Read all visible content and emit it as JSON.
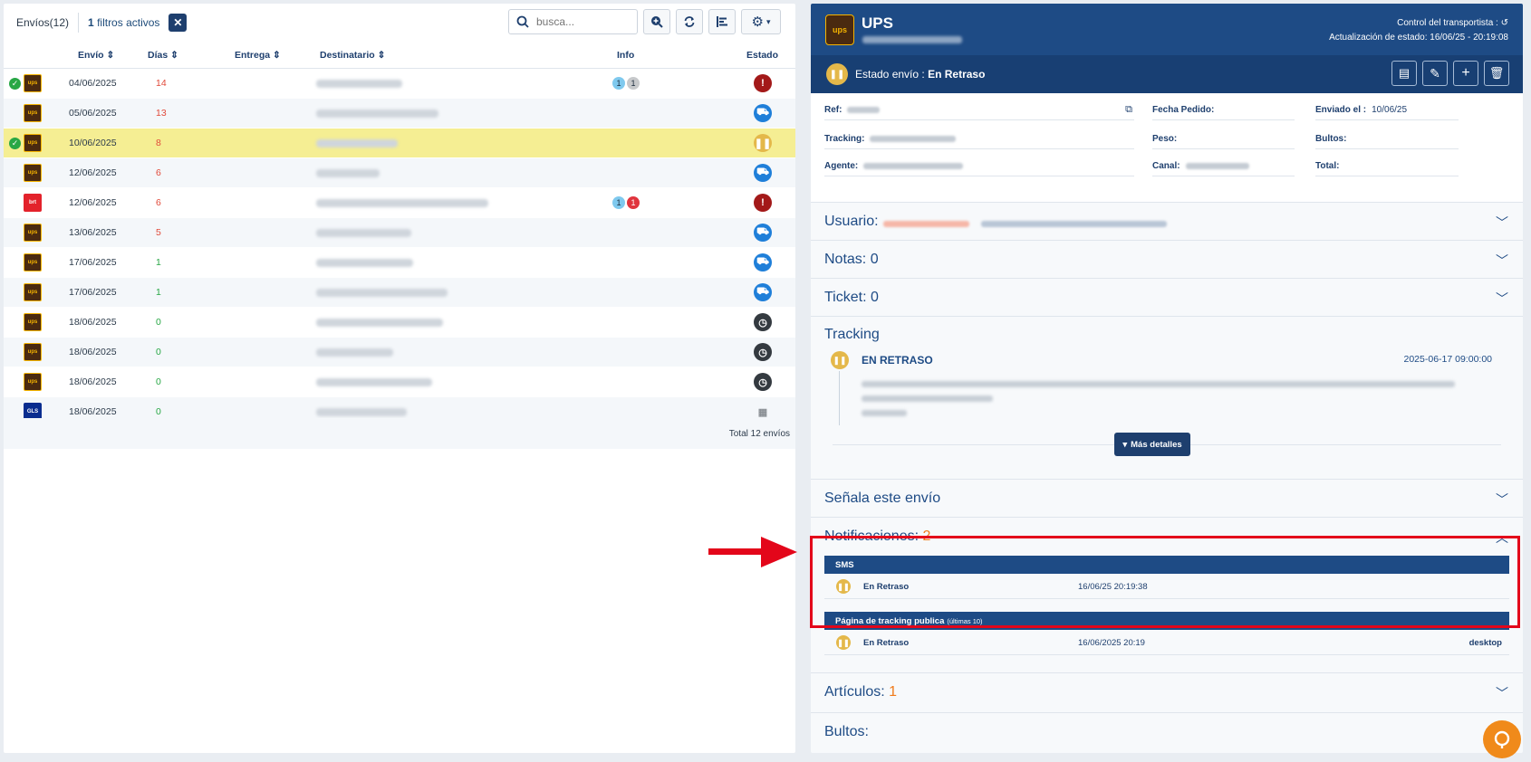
{
  "left": {
    "toolbar": {
      "title": "Envíos(12)",
      "filters_count": "1",
      "filters_text": "filtros activos",
      "clear_label": "✕",
      "search_placeholder": "busca..."
    },
    "columns": {
      "envio": "Envío ⇕",
      "dias": "Días ⇕",
      "entrega": "Entrega ⇕",
      "destinatario": "Destinatario ⇕",
      "info": "Info",
      "estado": "Estado"
    },
    "rows": [
      {
        "checked": true,
        "carrier": "ups",
        "date": "04/06/2025",
        "days": "14",
        "days_color": "red",
        "dest_w": 95,
        "info": [
          "1",
          "1"
        ],
        "info_colors": [
          "b",
          "g"
        ],
        "status": "error",
        "highlight": false
      },
      {
        "checked": false,
        "carrier": "ups",
        "date": "05/06/2025",
        "days": "13",
        "days_color": "red",
        "dest_w": 135,
        "info": [],
        "info_colors": [],
        "status": "truck",
        "highlight": false
      },
      {
        "checked": true,
        "carrier": "ups",
        "date": "10/06/2025",
        "days": "8",
        "days_color": "red",
        "dest_w": 90,
        "info": [],
        "info_colors": [],
        "status": "pause",
        "highlight": true
      },
      {
        "checked": false,
        "carrier": "ups",
        "date": "12/06/2025",
        "days": "6",
        "days_color": "red",
        "dest_w": 70,
        "info": [],
        "info_colors": [],
        "status": "truck",
        "highlight": false
      },
      {
        "checked": false,
        "carrier": "brt",
        "date": "12/06/2025",
        "days": "6",
        "days_color": "red",
        "dest_w": 190,
        "info": [
          "1",
          "1"
        ],
        "info_colors": [
          "b",
          "r"
        ],
        "status": "error",
        "highlight": false
      },
      {
        "checked": false,
        "carrier": "ups",
        "date": "13/06/2025",
        "days": "5",
        "days_color": "red",
        "dest_w": 105,
        "info": [],
        "info_colors": [],
        "status": "truck",
        "highlight": false
      },
      {
        "checked": false,
        "carrier": "ups",
        "date": "17/06/2025",
        "days": "1",
        "days_color": "green",
        "dest_w": 107,
        "info": [],
        "info_colors": [],
        "status": "truck",
        "highlight": false
      },
      {
        "checked": false,
        "carrier": "ups",
        "date": "17/06/2025",
        "days": "1",
        "days_color": "green",
        "dest_w": 145,
        "info": [],
        "info_colors": [],
        "status": "truck",
        "highlight": false
      },
      {
        "checked": false,
        "carrier": "ups",
        "date": "18/06/2025",
        "days": "0",
        "days_color": "green",
        "dest_w": 140,
        "info": [],
        "info_colors": [],
        "status": "clock",
        "highlight": false
      },
      {
        "checked": false,
        "carrier": "ups",
        "date": "18/06/2025",
        "days": "0",
        "days_color": "green",
        "dest_w": 85,
        "info": [],
        "info_colors": [],
        "status": "clock",
        "highlight": false
      },
      {
        "checked": false,
        "carrier": "ups",
        "date": "18/06/2025",
        "days": "0",
        "days_color": "green",
        "dest_w": 128,
        "info": [],
        "info_colors": [],
        "status": "clock",
        "highlight": false
      },
      {
        "checked": false,
        "carrier": "gls",
        "date": "18/06/2025",
        "days": "0",
        "days_color": "green",
        "dest_w": 100,
        "info": [],
        "info_colors": [],
        "status": "calendar",
        "highlight": false
      }
    ],
    "total": "Total 12 envíos"
  },
  "right": {
    "carrier": "UPS",
    "control_label": "Control del transportista :",
    "update_label": "Actualización de estado: 16/06/25 - 20:19:08",
    "status_prefix": "Estado envío : ",
    "status_value": "En Retraso",
    "fields": {
      "ref": "Ref:",
      "tracking": "Tracking:",
      "agente": "Agente:",
      "fecha_pedido": "Fecha Pedido:",
      "peso": "Peso:",
      "canal": "Canal:",
      "enviado_label": "Enviado el :",
      "enviado_value": "10/06/25",
      "bultos": "Bultos:",
      "total": "Total:"
    },
    "sections": {
      "usuario": "Usuario:",
      "notas": "Notas: 0",
      "ticket": "Ticket: 0",
      "tracking": "Tracking",
      "senala": "Señala este envío",
      "notificaciones": "Notificaciones:",
      "notificaciones_count": "2",
      "articulos": "Artículos:",
      "articulos_count": "1",
      "bultos": "Bultos:"
    },
    "tracking_event": {
      "title": "EN RETRASO",
      "date": "2025-06-17 09:00:00",
      "more_label": "Más detalles"
    },
    "notifications": [
      {
        "header": "SMS",
        "header_note": "",
        "label": "En Retraso",
        "time": "16/06/25 20:19:38",
        "extra": ""
      },
      {
        "header": "Página de tracking publica",
        "header_note": "(últimas 10)",
        "label": "En Retraso",
        "time": "16/06/2025 20:19",
        "extra": "desktop"
      }
    ]
  },
  "colors": {
    "primary": "#1e4b85",
    "accent_orange": "#f07a1a",
    "highlight_row": "#f5ee93",
    "annotation_red": "#e3061a"
  }
}
